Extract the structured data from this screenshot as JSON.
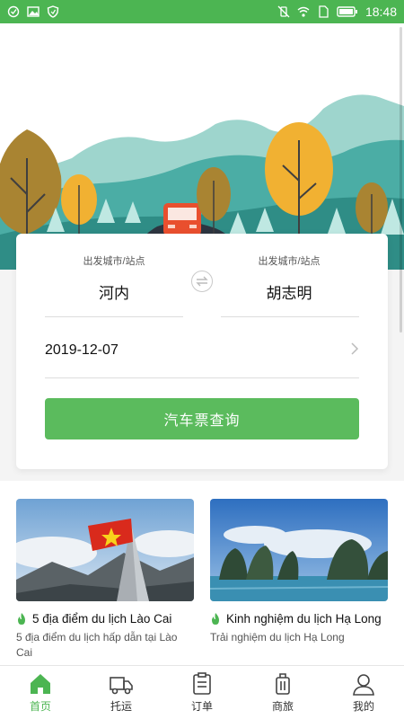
{
  "status_bar": {
    "time": "18:48",
    "left_icons": [
      "sync-check-icon",
      "image-icon",
      "shield-icon"
    ],
    "right_icons": [
      "vibrate-off-icon",
      "wifi-icon",
      "sim-icon",
      "battery-icon"
    ]
  },
  "search": {
    "from_label": "出发城市/站点",
    "from_city": "河内",
    "to_label": "出发城市/站点",
    "to_city": "胡志明",
    "date": "2019-12-07",
    "query_button": "汽车票查询"
  },
  "articles": [
    {
      "title": "5 địa điểm du lịch Lào Cai",
      "desc": "5 địa điểm du lịch hấp dẫn tại Lào Cai"
    },
    {
      "title": "Kinh nghiệm du lịch Hạ Long",
      "desc": "Trải nghiệm du lịch Hạ Long"
    }
  ],
  "tabs": [
    {
      "label": "首页",
      "icon": "home-icon",
      "active": true
    },
    {
      "label": "托运",
      "icon": "truck-icon",
      "active": false
    },
    {
      "label": "订单",
      "icon": "order-icon",
      "active": false
    },
    {
      "label": "商旅",
      "icon": "luggage-icon",
      "active": false
    },
    {
      "label": "我的",
      "icon": "profile-icon",
      "active": false
    }
  ],
  "colors": {
    "accent": "#4cb552",
    "button": "#5bbb5d"
  }
}
